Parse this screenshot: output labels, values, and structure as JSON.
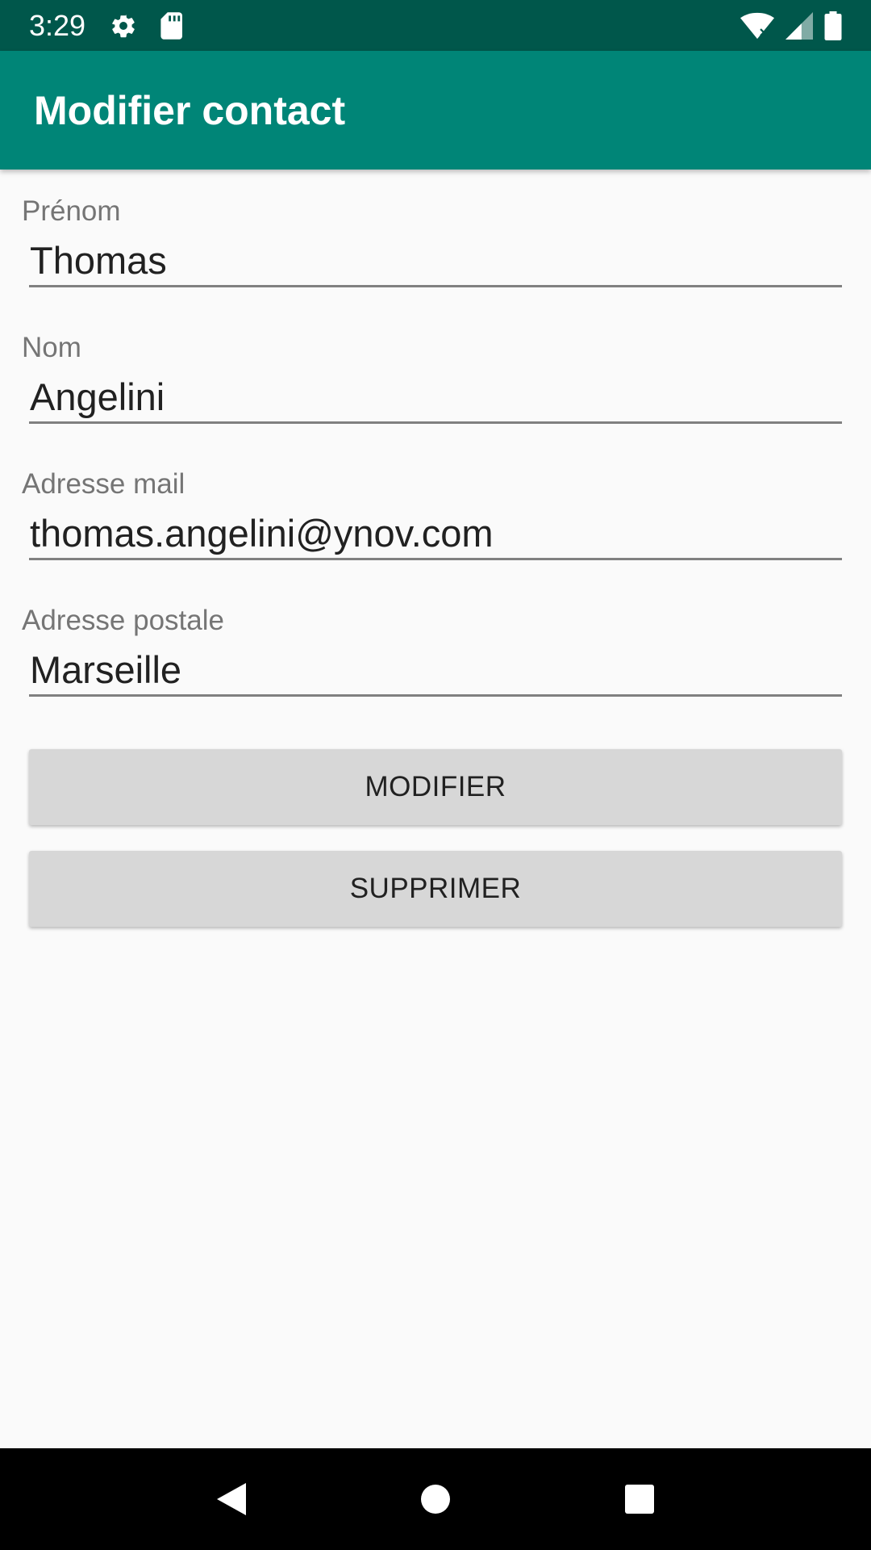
{
  "status_bar": {
    "time": "3:29",
    "icons_left": [
      "gear-icon",
      "sd-card-icon"
    ],
    "icons_right": [
      "wifi-icon",
      "signal-icon",
      "battery-icon"
    ]
  },
  "app_bar": {
    "title": "Modifier contact"
  },
  "form": {
    "fields": [
      {
        "label": "Prénom",
        "value": "Thomas"
      },
      {
        "label": "Nom",
        "value": "Angelini"
      },
      {
        "label": "Adresse mail",
        "value": "thomas.angelini@ynov.com"
      },
      {
        "label": "Adresse postale",
        "value": "Marseille"
      }
    ],
    "modify_label": "MODIFIER",
    "delete_label": "SUPPRIMER"
  },
  "nav_bar": {
    "buttons": [
      "back-icon",
      "home-icon",
      "recents-icon"
    ]
  },
  "colors": {
    "status_bar": "#00574b",
    "app_bar": "#008577",
    "background": "#fafafa",
    "button": "#d7d7d7"
  }
}
